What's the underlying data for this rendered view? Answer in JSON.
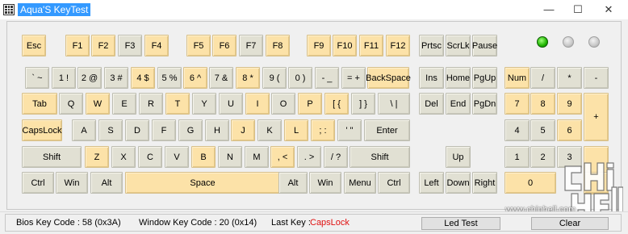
{
  "window": {
    "title": "Aqua'S KeyTest",
    "minimize": "—",
    "maximize": "☐",
    "close": "✕"
  },
  "keys": [
    {
      "id": "esc",
      "label": "Esc",
      "hl": true
    },
    {
      "id": "f1",
      "label": "F1",
      "hl": true
    },
    {
      "id": "f2",
      "label": "F2",
      "hl": true
    },
    {
      "id": "f3",
      "label": "F3",
      "hl": false
    },
    {
      "id": "f4",
      "label": "F4",
      "hl": true
    },
    {
      "id": "f5",
      "label": "F5",
      "hl": true
    },
    {
      "id": "f6",
      "label": "F6",
      "hl": true
    },
    {
      "id": "f7",
      "label": "F7",
      "hl": false
    },
    {
      "id": "f8",
      "label": "F8",
      "hl": true
    },
    {
      "id": "f9",
      "label": "F9",
      "hl": true
    },
    {
      "id": "f10",
      "label": "F10",
      "hl": true
    },
    {
      "id": "f11",
      "label": "F11",
      "hl": true
    },
    {
      "id": "f12",
      "label": "F12",
      "hl": true
    },
    {
      "id": "prtsc",
      "label": "Prtsc",
      "hl": false
    },
    {
      "id": "scrlk",
      "label": "ScrLk",
      "hl": false
    },
    {
      "id": "pause",
      "label": "Pause",
      "hl": false
    },
    {
      "id": "backtick",
      "label": "` ~",
      "hl": false
    },
    {
      "id": "1",
      "label": "1 !",
      "hl": false
    },
    {
      "id": "2",
      "label": "2 @",
      "hl": false
    },
    {
      "id": "3",
      "label": "3 #",
      "hl": false
    },
    {
      "id": "4",
      "label": "4 $",
      "hl": true
    },
    {
      "id": "5",
      "label": "5 %",
      "hl": false
    },
    {
      "id": "6",
      "label": "6 ^",
      "hl": true
    },
    {
      "id": "7",
      "label": "7 &",
      "hl": false
    },
    {
      "id": "8",
      "label": "8 *",
      "hl": true
    },
    {
      "id": "9",
      "label": "9 (",
      "hl": false
    },
    {
      "id": "0",
      "label": "0 )",
      "hl": false
    },
    {
      "id": "minus",
      "label": "- _",
      "hl": false
    },
    {
      "id": "equals",
      "label": "= +",
      "hl": false
    },
    {
      "id": "backspace",
      "label": "BackSpace",
      "hl": true
    },
    {
      "id": "ins",
      "label": "Ins",
      "hl": false
    },
    {
      "id": "home",
      "label": "Home",
      "hl": false
    },
    {
      "id": "pgup",
      "label": "PgUp",
      "hl": false
    },
    {
      "id": "num",
      "label": "Num",
      "hl": true
    },
    {
      "id": "numdiv",
      "label": "/",
      "hl": false
    },
    {
      "id": "nummul",
      "label": "*",
      "hl": false
    },
    {
      "id": "numsub",
      "label": "-",
      "hl": false
    },
    {
      "id": "tab",
      "label": "Tab",
      "hl": true
    },
    {
      "id": "q",
      "label": "Q",
      "hl": false
    },
    {
      "id": "w",
      "label": "W",
      "hl": true
    },
    {
      "id": "e",
      "label": "E",
      "hl": false
    },
    {
      "id": "r",
      "label": "R",
      "hl": false
    },
    {
      "id": "t",
      "label": "T",
      "hl": true
    },
    {
      "id": "y",
      "label": "Y",
      "hl": false
    },
    {
      "id": "u",
      "label": "U",
      "hl": false
    },
    {
      "id": "i",
      "label": "I",
      "hl": true
    },
    {
      "id": "o",
      "label": "O",
      "hl": false
    },
    {
      "id": "p",
      "label": "P",
      "hl": true
    },
    {
      "id": "lbracket",
      "label": "[ {",
      "hl": true
    },
    {
      "id": "rbracket",
      "label": "] }",
      "hl": false
    },
    {
      "id": "backslash",
      "label": "\\ |",
      "hl": false
    },
    {
      "id": "del",
      "label": "Del",
      "hl": false
    },
    {
      "id": "end",
      "label": "End",
      "hl": false
    },
    {
      "id": "pgdn",
      "label": "PgDn",
      "hl": false
    },
    {
      "id": "num7",
      "label": "7",
      "hl": true
    },
    {
      "id": "num8",
      "label": "8",
      "hl": true
    },
    {
      "id": "num9",
      "label": "9",
      "hl": true
    },
    {
      "id": "numplus",
      "label": "+",
      "hl": true
    },
    {
      "id": "capslock",
      "label": "CapsLock",
      "hl": true
    },
    {
      "id": "a",
      "label": "A",
      "hl": false
    },
    {
      "id": "s",
      "label": "S",
      "hl": false
    },
    {
      "id": "d",
      "label": "D",
      "hl": false
    },
    {
      "id": "f",
      "label": "F",
      "hl": false
    },
    {
      "id": "g",
      "label": "G",
      "hl": false
    },
    {
      "id": "h",
      "label": "H",
      "hl": false
    },
    {
      "id": "j",
      "label": "J",
      "hl": true
    },
    {
      "id": "k",
      "label": "K",
      "hl": false
    },
    {
      "id": "l",
      "label": "L",
      "hl": true
    },
    {
      "id": "semicolon",
      "label": "; :",
      "hl": true
    },
    {
      "id": "quote",
      "label": "' \"",
      "hl": false
    },
    {
      "id": "enter",
      "label": "Enter",
      "hl": false
    },
    {
      "id": "num4",
      "label": "4",
      "hl": false
    },
    {
      "id": "num5",
      "label": "5",
      "hl": false
    },
    {
      "id": "num6",
      "label": "6",
      "hl": true
    },
    {
      "id": "lshift",
      "label": "Shift",
      "hl": false
    },
    {
      "id": "z",
      "label": "Z",
      "hl": true
    },
    {
      "id": "x",
      "label": "X",
      "hl": false
    },
    {
      "id": "c",
      "label": "C",
      "hl": false
    },
    {
      "id": "v",
      "label": "V",
      "hl": false
    },
    {
      "id": "b",
      "label": "B",
      "hl": true
    },
    {
      "id": "n",
      "label": "N",
      "hl": false
    },
    {
      "id": "m",
      "label": "M",
      "hl": false
    },
    {
      "id": "comma",
      "label": ", <",
      "hl": true
    },
    {
      "id": "period",
      "label": ". >",
      "hl": false
    },
    {
      "id": "slash",
      "label": "/ ?",
      "hl": false
    },
    {
      "id": "rshift",
      "label": "Shift",
      "hl": false
    },
    {
      "id": "up",
      "label": "Up",
      "hl": false
    },
    {
      "id": "num1",
      "label": "1",
      "hl": false
    },
    {
      "id": "num2",
      "label": "2",
      "hl": false
    },
    {
      "id": "num3",
      "label": "3",
      "hl": false
    },
    {
      "id": "numenter",
      "label": "",
      "hl": true
    },
    {
      "id": "lctrl",
      "label": "Ctrl",
      "hl": false
    },
    {
      "id": "lwin",
      "label": "Win",
      "hl": false
    },
    {
      "id": "lalt",
      "label": "Alt",
      "hl": false
    },
    {
      "id": "space",
      "label": "Space",
      "hl": true
    },
    {
      "id": "ralt",
      "label": "Alt",
      "hl": false
    },
    {
      "id": "rwin",
      "label": "Win",
      "hl": false
    },
    {
      "id": "menu",
      "label": "Menu",
      "hl": false
    },
    {
      "id": "rctrl",
      "label": "Ctrl",
      "hl": false
    },
    {
      "id": "left",
      "label": "Left",
      "hl": false
    },
    {
      "id": "down",
      "label": "Down",
      "hl": false
    },
    {
      "id": "right",
      "label": "Right",
      "hl": false
    },
    {
      "id": "num0",
      "label": "0",
      "hl": true
    },
    {
      "id": "numdot",
      "label": "",
      "hl": true
    }
  ],
  "leds": [
    {
      "id": "num-lock",
      "on": true
    },
    {
      "id": "caps-lock",
      "on": false
    },
    {
      "id": "scroll-lock",
      "on": false
    }
  ],
  "status": {
    "bios_key_code": "Bios Key Code : 58 (0x3A)",
    "window_key_code": "Window Key Code : 20 (0x14)",
    "last_key_label": "Last Key :",
    "last_key_value": "CapsLock",
    "led_test_button": "Led Test",
    "clear_button": "Clear"
  },
  "watermark": {
    "url": "www.chiphell.com"
  },
  "colors": {
    "key_default": "#e1e0d3",
    "key_highlight": "#fce2a8",
    "last_key_text": "#e01010"
  }
}
